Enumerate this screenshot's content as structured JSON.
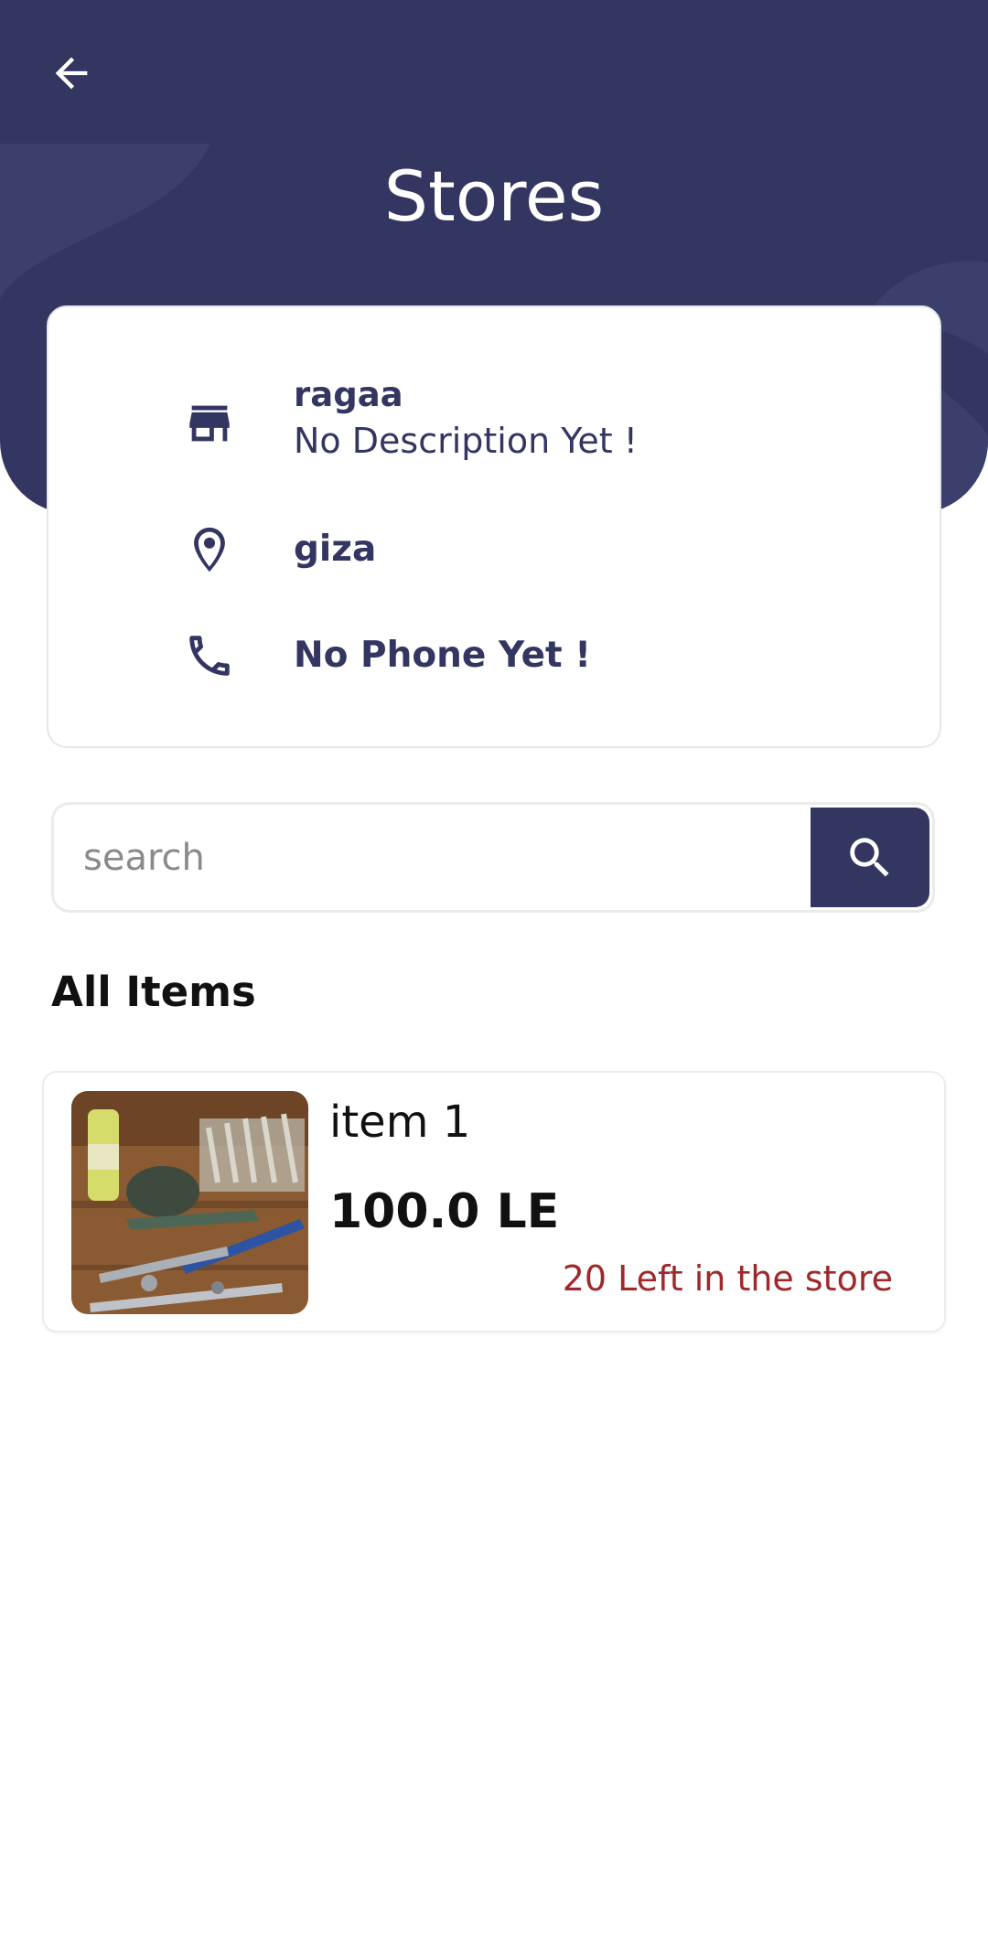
{
  "header": {
    "title": "Stores",
    "icons": {
      "back": "arrow-back-icon"
    },
    "colors": {
      "primary": "#323660"
    }
  },
  "store": {
    "name": "ragaa",
    "description": "No Description Yet !",
    "location": "giza",
    "phone": "No Phone Yet !",
    "icons": {
      "store": "storefront-icon",
      "location": "location-pin-icon",
      "phone": "phone-icon"
    }
  },
  "search": {
    "placeholder": "search",
    "value": "",
    "icon": "search-icon"
  },
  "items_section": {
    "title": "All Items",
    "items": [
      {
        "name": "item 1",
        "price": "100.0 LE",
        "stock": "20 Left in the store",
        "stock_color": "#a0282a"
      }
    ]
  }
}
